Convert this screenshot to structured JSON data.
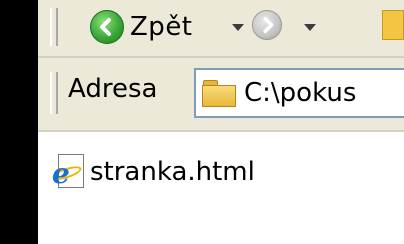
{
  "toolbar": {
    "back_label": "Zpět",
    "icons": [
      "back-arrow-icon",
      "dropdown-arrow-icon",
      "forward-arrow-icon",
      "dropdown-arrow-icon",
      "folder-up-icon"
    ]
  },
  "address_bar": {
    "label": "Adresa",
    "value": "C:\\pokus",
    "icon": "folder-icon"
  },
  "content": {
    "items": [
      {
        "name": "stranka.html",
        "icon": "internet-explorer-icon"
      }
    ]
  },
  "colors": {
    "window_chrome": "#ece9d8",
    "address_border": "#7f9db9",
    "back_green": "#3aa838",
    "ie_blue": "#1b6fd1"
  }
}
